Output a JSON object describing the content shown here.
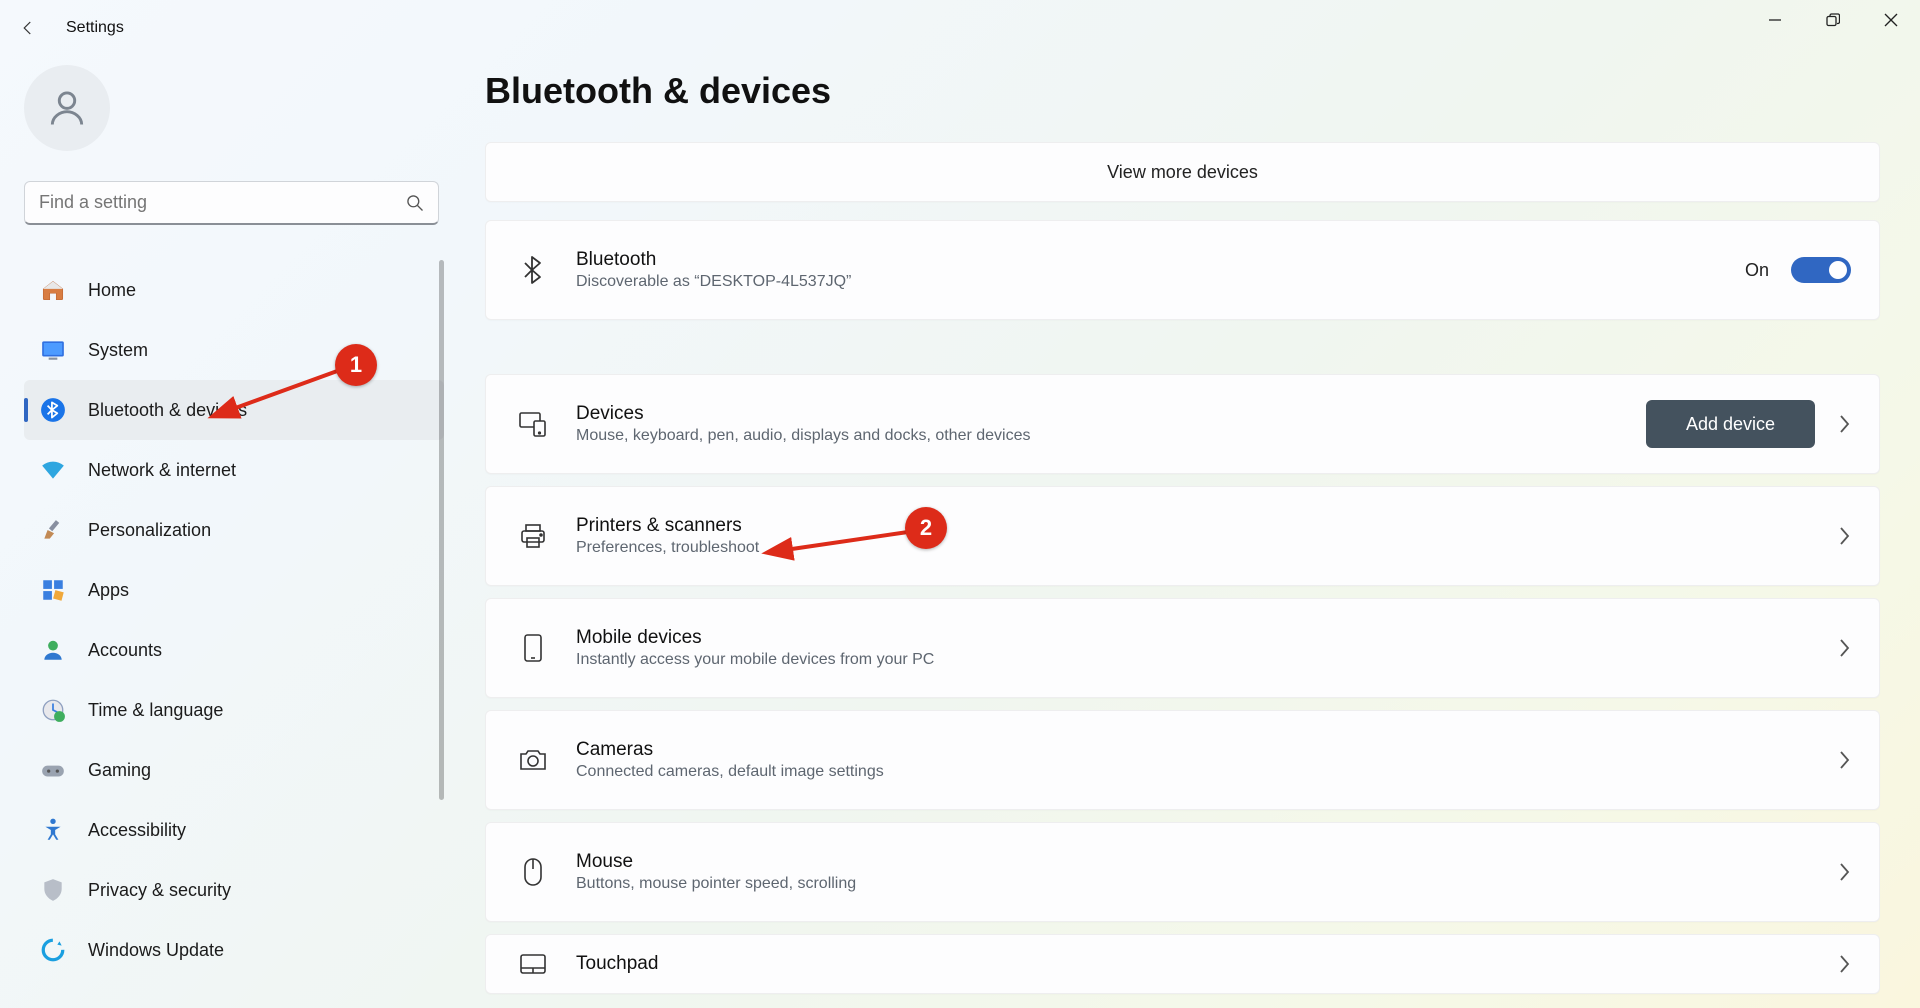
{
  "window": {
    "title": "Settings"
  },
  "search": {
    "placeholder": "Find a setting"
  },
  "sidebar": {
    "items": [
      {
        "label": "Home"
      },
      {
        "label": "System"
      },
      {
        "label": "Bluetooth & devices"
      },
      {
        "label": "Network & internet"
      },
      {
        "label": "Personalization"
      },
      {
        "label": "Apps"
      },
      {
        "label": "Accounts"
      },
      {
        "label": "Time & language"
      },
      {
        "label": "Gaming"
      },
      {
        "label": "Accessibility"
      },
      {
        "label": "Privacy & security"
      },
      {
        "label": "Windows Update"
      }
    ],
    "active_index": 2
  },
  "page": {
    "title": "Bluetooth & devices",
    "view_more": "View more devices",
    "bluetooth": {
      "title": "Bluetooth",
      "sub": "Discoverable as “DESKTOP-4L537JQ”",
      "state_label": "On"
    },
    "devices": {
      "title": "Devices",
      "sub": "Mouse, keyboard, pen, audio, displays and docks, other devices",
      "button": "Add device"
    },
    "printers": {
      "title": "Printers & scanners",
      "sub": "Preferences, troubleshoot"
    },
    "mobile": {
      "title": "Mobile devices",
      "sub": "Instantly access your mobile devices from your PC"
    },
    "cameras": {
      "title": "Cameras",
      "sub": "Connected cameras, default image settings"
    },
    "mouse": {
      "title": "Mouse",
      "sub": "Buttons, mouse pointer speed, scrolling"
    },
    "touchpad": {
      "title": "Touchpad"
    }
  },
  "annotations": {
    "badge1": "1",
    "badge2": "2"
  }
}
